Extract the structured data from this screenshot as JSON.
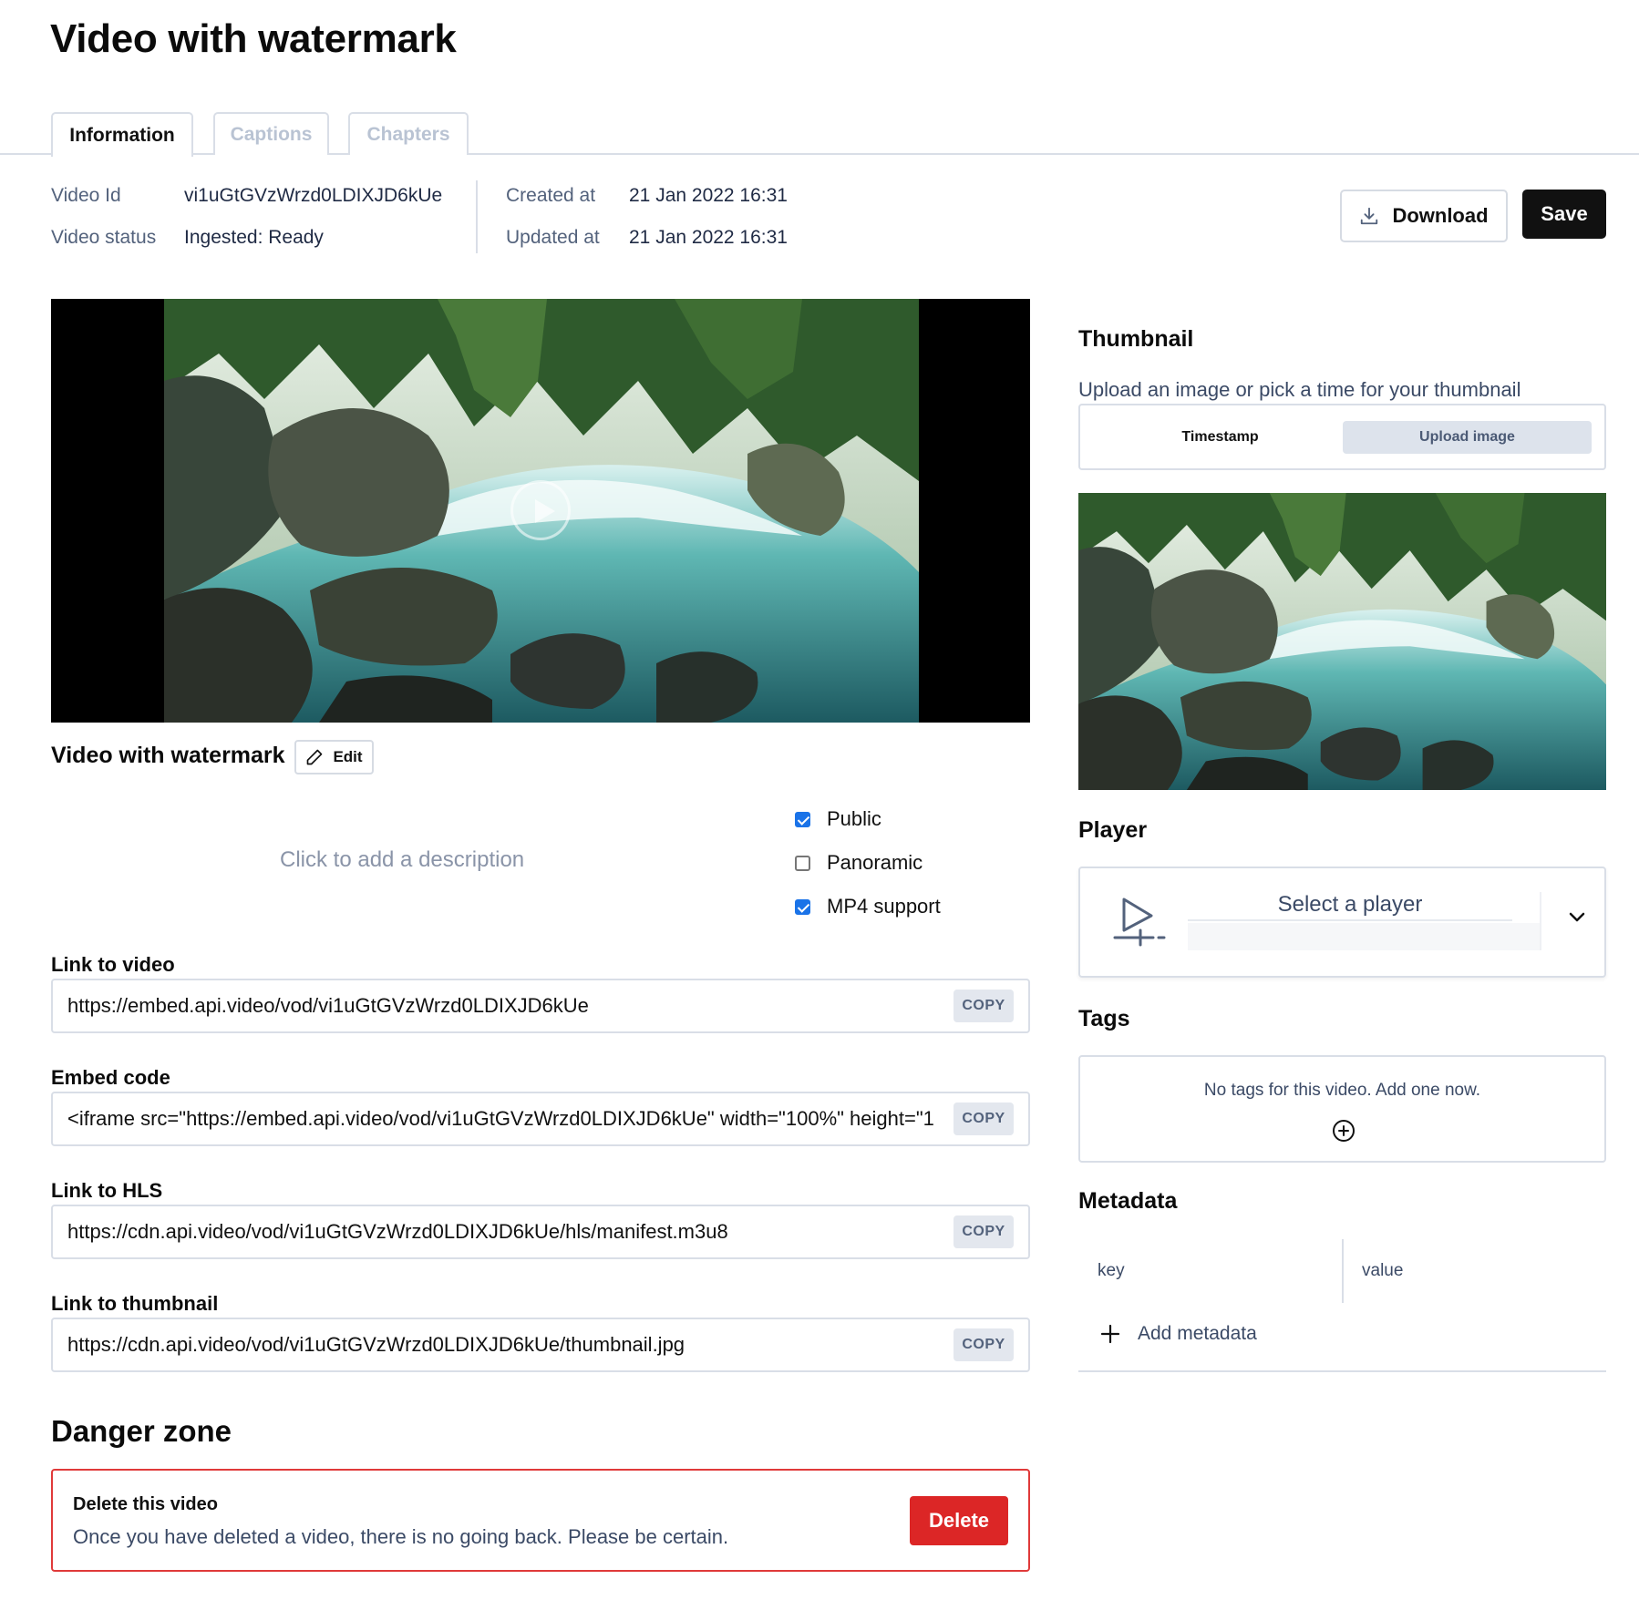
{
  "page": {
    "title": "Video with watermark"
  },
  "tabs": [
    {
      "label": "Information",
      "active": true
    },
    {
      "label": "Captions",
      "active": false
    },
    {
      "label": "Chapters",
      "active": false
    }
  ],
  "info": {
    "video_id_label": "Video Id",
    "video_id": "vi1uGtGVzWrzd0LDIXJD6kUe",
    "status_label": "Video status",
    "status": "Ingested: Ready",
    "created_label": "Created at",
    "created": "21 Jan 2022 16:31",
    "updated_label": "Updated at",
    "updated": "21 Jan 2022 16:31"
  },
  "actions": {
    "download_label": "Download",
    "save_label": "Save"
  },
  "video": {
    "name": "Video with watermark",
    "edit_label": "Edit",
    "description_placeholder": "Click to add a description"
  },
  "options": [
    {
      "label": "Public",
      "checked": true
    },
    {
      "label": "Panoramic",
      "checked": false
    },
    {
      "label": "MP4 support",
      "checked": true
    }
  ],
  "links": {
    "copy_label": "COPY",
    "video_label": "Link to video",
    "video_url": "https://embed.api.video/vod/vi1uGtGVzWrzd0LDIXJD6kUe",
    "embed_label": "Embed code",
    "embed_code": "<iframe src=\"https://embed.api.video/vod/vi1uGtGVzWrzd0LDIXJD6kUe\" width=\"100%\" height=\"1",
    "hls_label": "Link to HLS",
    "hls_url": "https://cdn.api.video/vod/vi1uGtGVzWrzd0LDIXJD6kUe/hls/manifest.m3u8",
    "thumb_label": "Link to thumbnail",
    "thumb_url": "https://cdn.api.video/vod/vi1uGtGVzWrzd0LDIXJD6kUe/thumbnail.jpg"
  },
  "danger": {
    "title": "Danger zone",
    "heading": "Delete this video",
    "description": "Once you have deleted a video, there is no going back. Please be certain.",
    "delete_label": "Delete"
  },
  "thumbnail": {
    "title": "Thumbnail",
    "subtitle": "Upload an image or pick a time for your thumbnail",
    "timestamp_label": "Timestamp",
    "upload_label": "Upload image"
  },
  "player": {
    "title": "Player",
    "select_placeholder": "Select a player"
  },
  "tags": {
    "title": "Tags",
    "empty_text": "No tags for this video. Add one now."
  },
  "metadata": {
    "title": "Metadata",
    "key_placeholder": "key",
    "value_placeholder": "value",
    "add_label": "Add metadata"
  },
  "colors": {
    "primary": "#111111",
    "danger": "#dc2626",
    "checkbox": "#1a73e8",
    "border": "#d9dee7"
  }
}
